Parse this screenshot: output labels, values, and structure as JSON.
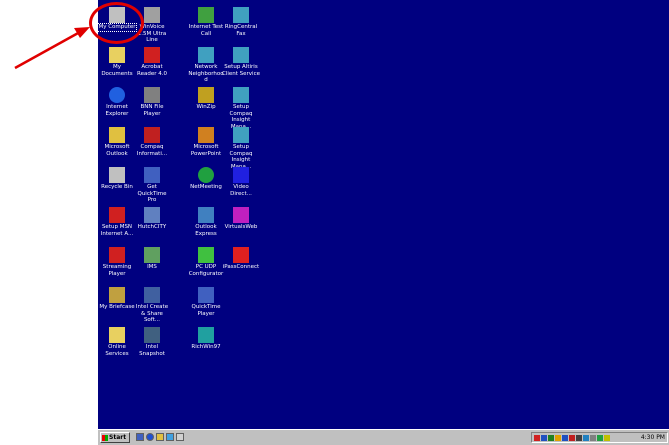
{
  "desktop": {
    "icons": [
      {
        "label": "My Computer",
        "icon": "my-computer-icon",
        "selected": true
      },
      {
        "label": "WinVoice 1.5M Ultra Line",
        "icon": "ultra-line-icon"
      },
      {
        "label": "Internet Test Call",
        "icon": "test-call-icon"
      },
      {
        "label": "RingCentral Fax",
        "icon": "fax-icon"
      },
      {
        "label": "My Documents",
        "icon": "folder-icon"
      },
      {
        "label": "Acrobat Reader 4.0",
        "icon": "acrobat-icon"
      },
      {
        "label": "Network Neighborhood",
        "icon": "network-icon"
      },
      {
        "label": "Setup Altiris Client Service",
        "icon": "setup-icon"
      },
      {
        "label": "Internet Explorer",
        "icon": "ie-icon"
      },
      {
        "label": "BNN File Player",
        "icon": "player-icon"
      },
      {
        "label": "WinZip",
        "icon": "winzip-icon"
      },
      {
        "label": "Setup Compaq Insight Mana...",
        "icon": "setup-icon"
      },
      {
        "label": "Microsoft Outlook",
        "icon": "outlook-icon"
      },
      {
        "label": "Compaq Informati...",
        "icon": "compaq-icon"
      },
      {
        "label": "Microsoft PowerPoint",
        "icon": "powerpoint-icon"
      },
      {
        "label": "Setup Compaq Insight Mana...",
        "icon": "setup-icon"
      },
      {
        "label": "Recycle Bin",
        "icon": "recycle-bin-icon"
      },
      {
        "label": "Get QuickTime Pro",
        "icon": "quicktime-icon"
      },
      {
        "label": "NetMeeting",
        "icon": "netmeeting-icon"
      },
      {
        "label": "Video Direct...",
        "icon": "video-icon"
      },
      {
        "label": "Setup MSN Internet A...",
        "icon": "msn-icon"
      },
      {
        "label": "HutchCITY",
        "icon": "hutchcity-icon"
      },
      {
        "label": "Outlook Express",
        "icon": "outlook-express-icon"
      },
      {
        "label": "VirtualsWeb",
        "icon": "web-icon"
      },
      {
        "label": "Streaming Player",
        "icon": "streaming-icon"
      },
      {
        "label": "IMS",
        "icon": "ims-icon"
      },
      {
        "label": "PC UDP Configurator",
        "icon": "config-icon"
      },
      {
        "label": "iPassConnect",
        "icon": "ipass-icon"
      },
      {
        "label": "My Briefcase",
        "icon": "briefcase-icon"
      },
      {
        "label": "Intel Create & Share Soft...",
        "icon": "intel-icon"
      },
      {
        "label": "QuickTime Player",
        "icon": "quicktime-icon"
      },
      {
        "label": "",
        "icon": "",
        "empty": true
      },
      {
        "label": "Online Services",
        "icon": "folder-icon"
      },
      {
        "label": "Intel Snapshot",
        "icon": "snapshot-icon"
      },
      {
        "label": "RichWin97",
        "icon": "richwin-icon"
      }
    ]
  },
  "taskbar": {
    "start_label": "Start",
    "clock": "4:30 PM"
  },
  "colors": {
    "desktop": "#000080",
    "annotation": "#e00000",
    "taskbar": "#c0c0c0"
  }
}
